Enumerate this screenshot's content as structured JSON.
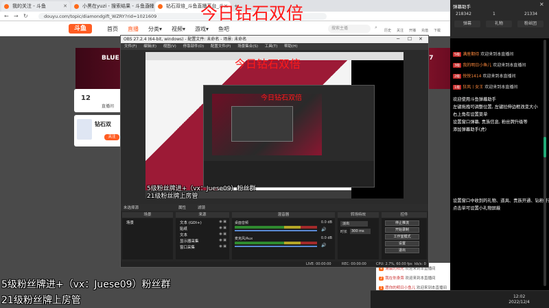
{
  "browser": {
    "tabs": [
      "我的关注 - 斗鱼",
      "小黑在yuzi - 搜索结果 - 斗鱼直播",
      "钻石双倍_斗鱼直播平台_斗..."
    ],
    "url": "douyu.com/topic/diamondgift_WZRY?rid=1021609",
    "new_tab": "+"
  },
  "site": {
    "logo": "斗鱼",
    "nav": [
      "首页",
      "直播",
      "分类▾",
      "视频▾",
      "游戏▾",
      "鱼吧"
    ],
    "search_placeholder": "搜索主播",
    "header_icons": [
      "历史",
      "关注",
      "开播",
      "充值",
      "下载"
    ],
    "banner_text_left": "BLUE",
    "banner_text_right": "/7",
    "ranks": {
      "count": "12",
      "label": "直播间"
    },
    "anchor_card_title": "钻石双",
    "anchor_card_button": "关注"
  },
  "right_panel": {
    "title": "弹幕助手",
    "stats": [
      "218342",
      "1",
      "21334"
    ],
    "tabs": [
      "弹幕",
      "礼物",
      "粉丝团"
    ],
    "messages": [
      {
        "badge": "5级",
        "name": "满座期待",
        "text": "欢迎来到本直播间"
      },
      {
        "badge": "3级",
        "name": "我的明日小鱼儿",
        "text": "欢迎来到本直播间"
      },
      {
        "badge": "2级",
        "name": "悦悦1414",
        "text": "欢迎来到本直播间"
      },
      {
        "badge": "1级",
        "name": "狂风丨女王",
        "text": "欢迎来到本直播间"
      }
    ],
    "info_block_1": [
      "欢迎使用斗鱼弹幕助手",
      "左键拖拽可调整位置, 左键拉伸边框改变大小",
      "右上角有设置菜单",
      "设置窗口弹幕, 贵族信息, 粉丝牌升级等",
      "添加弹幕助手(虎)"
    ],
    "info_block_2": [
      "设置窗口中收到的礼物、道具、贵族开通、钻粉开通",
      "点击单可设置小礼物屏蔽"
    ]
  },
  "chat_bottom": [
    {
      "lv": "4",
      "name": "清晨的阳光",
      "text": "欢迎来到本直播间"
    },
    {
      "lv": "2",
      "name": "我在你身旁",
      "text": "欢迎来到本直播间"
    },
    {
      "lv": "1",
      "name": "愿你的明日小鱼儿",
      "text": "欢迎来到本直播间"
    }
  ],
  "taskbar": {
    "time": "12:02",
    "date": "2022/12/4"
  },
  "obs": {
    "title": "OBS 27.2.4 (64-bit, windows) - 配置文件: 未命名 - 场景: 未命名",
    "menu": [
      "文件(F)",
      "编辑(E)",
      "视图(V)",
      "停靠部件(D)",
      "配置文件(P)",
      "场景集合(S)",
      "工具(T)",
      "帮助(H)"
    ],
    "no_source": "未选择源",
    "properties": "属性",
    "filters": "滤镜",
    "docks": [
      "场景",
      "来源",
      "混音器",
      "转场特效",
      "控件"
    ],
    "scene_item": "场景",
    "sources": [
      "文本 (GDI+)",
      "贴纸",
      "文本",
      "显示器采集",
      "窗口采集"
    ],
    "mixer": [
      {
        "label": "桌面音频",
        "db": "0.0 dB"
      },
      {
        "label": "麦克风/Aux",
        "db": "0.0 dB"
      }
    ],
    "transition": {
      "type": "淡出",
      "duration_label": "时长",
      "duration": "300 ms"
    },
    "controls": [
      "停止推流",
      "开始录制",
      "工作室模式",
      "设置",
      "退出"
    ],
    "status": {
      "live": "LIVE: 00:00:00",
      "rec": "REC: 00:00:00",
      "cpu": "CPU: 2.7%, 60.00 fps",
      "kb": "kb/s: 0"
    }
  },
  "overlays": {
    "headline": "今日钻石双倍",
    "fans_line": "5级粉丝牌进+（vx：Juese09）粉丝群",
    "manager_line": "21级粉丝牌上房管"
  }
}
